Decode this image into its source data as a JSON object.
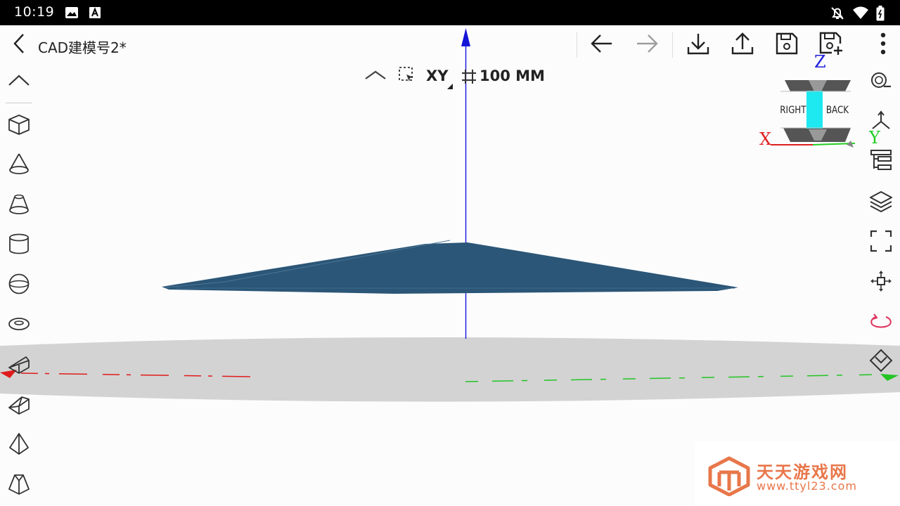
{
  "status_bar": {
    "time": "10:19",
    "left_icons": [
      "image-icon",
      "font-a-icon"
    ],
    "right_icons": [
      "bell-off-icon",
      "wifi-icon",
      "battery-icon"
    ]
  },
  "header": {
    "back_icon": "chevron-left-icon",
    "title": "CAD建模号2*",
    "actions": [
      "undo-arrow-icon",
      "redo-arrow-icon",
      "download-icon",
      "share-upload-icon",
      "save-icon",
      "save-as-icon",
      "more-vertical-icon"
    ]
  },
  "view_bar": {
    "collapse_icon": "chevron-up-icon",
    "select_icon": "selection-box-icon",
    "plane_label": "XY",
    "grid_icon": "grid-icon",
    "grid_size": "100 MM"
  },
  "left_tools": [
    "chevron-up-icon",
    "box-icon",
    "cone-icon",
    "frustum-icon",
    "cylinder-icon",
    "sphere-icon",
    "torus-icon",
    "wedge-icon",
    "prism-icon",
    "pyramid-icon",
    "truncated-pyramid-icon"
  ],
  "right_tools": [
    "zoom-search-icon",
    "axes-3d-icon",
    "tree-icon",
    "layers-icon",
    "fit-screen-icon",
    "pan-move-icon",
    "rotate-icon",
    "fold-view-icon"
  ],
  "nav_cube": {
    "face_right": "RIGHT",
    "face_back": "BACK",
    "axis_x": "X",
    "axis_y": "Y",
    "axis_z": "Z",
    "colors": {
      "x": "#e02020",
      "y": "#22cc22",
      "z": "#2020dd",
      "highlight": "#1ee8f0"
    }
  },
  "scene": {
    "model_color": "#2b5677",
    "ground_color": "#d3d3d3"
  },
  "watermark": {
    "title": "天天游戏网",
    "url": "www.ttyl23.com",
    "color": "#e8774a"
  }
}
